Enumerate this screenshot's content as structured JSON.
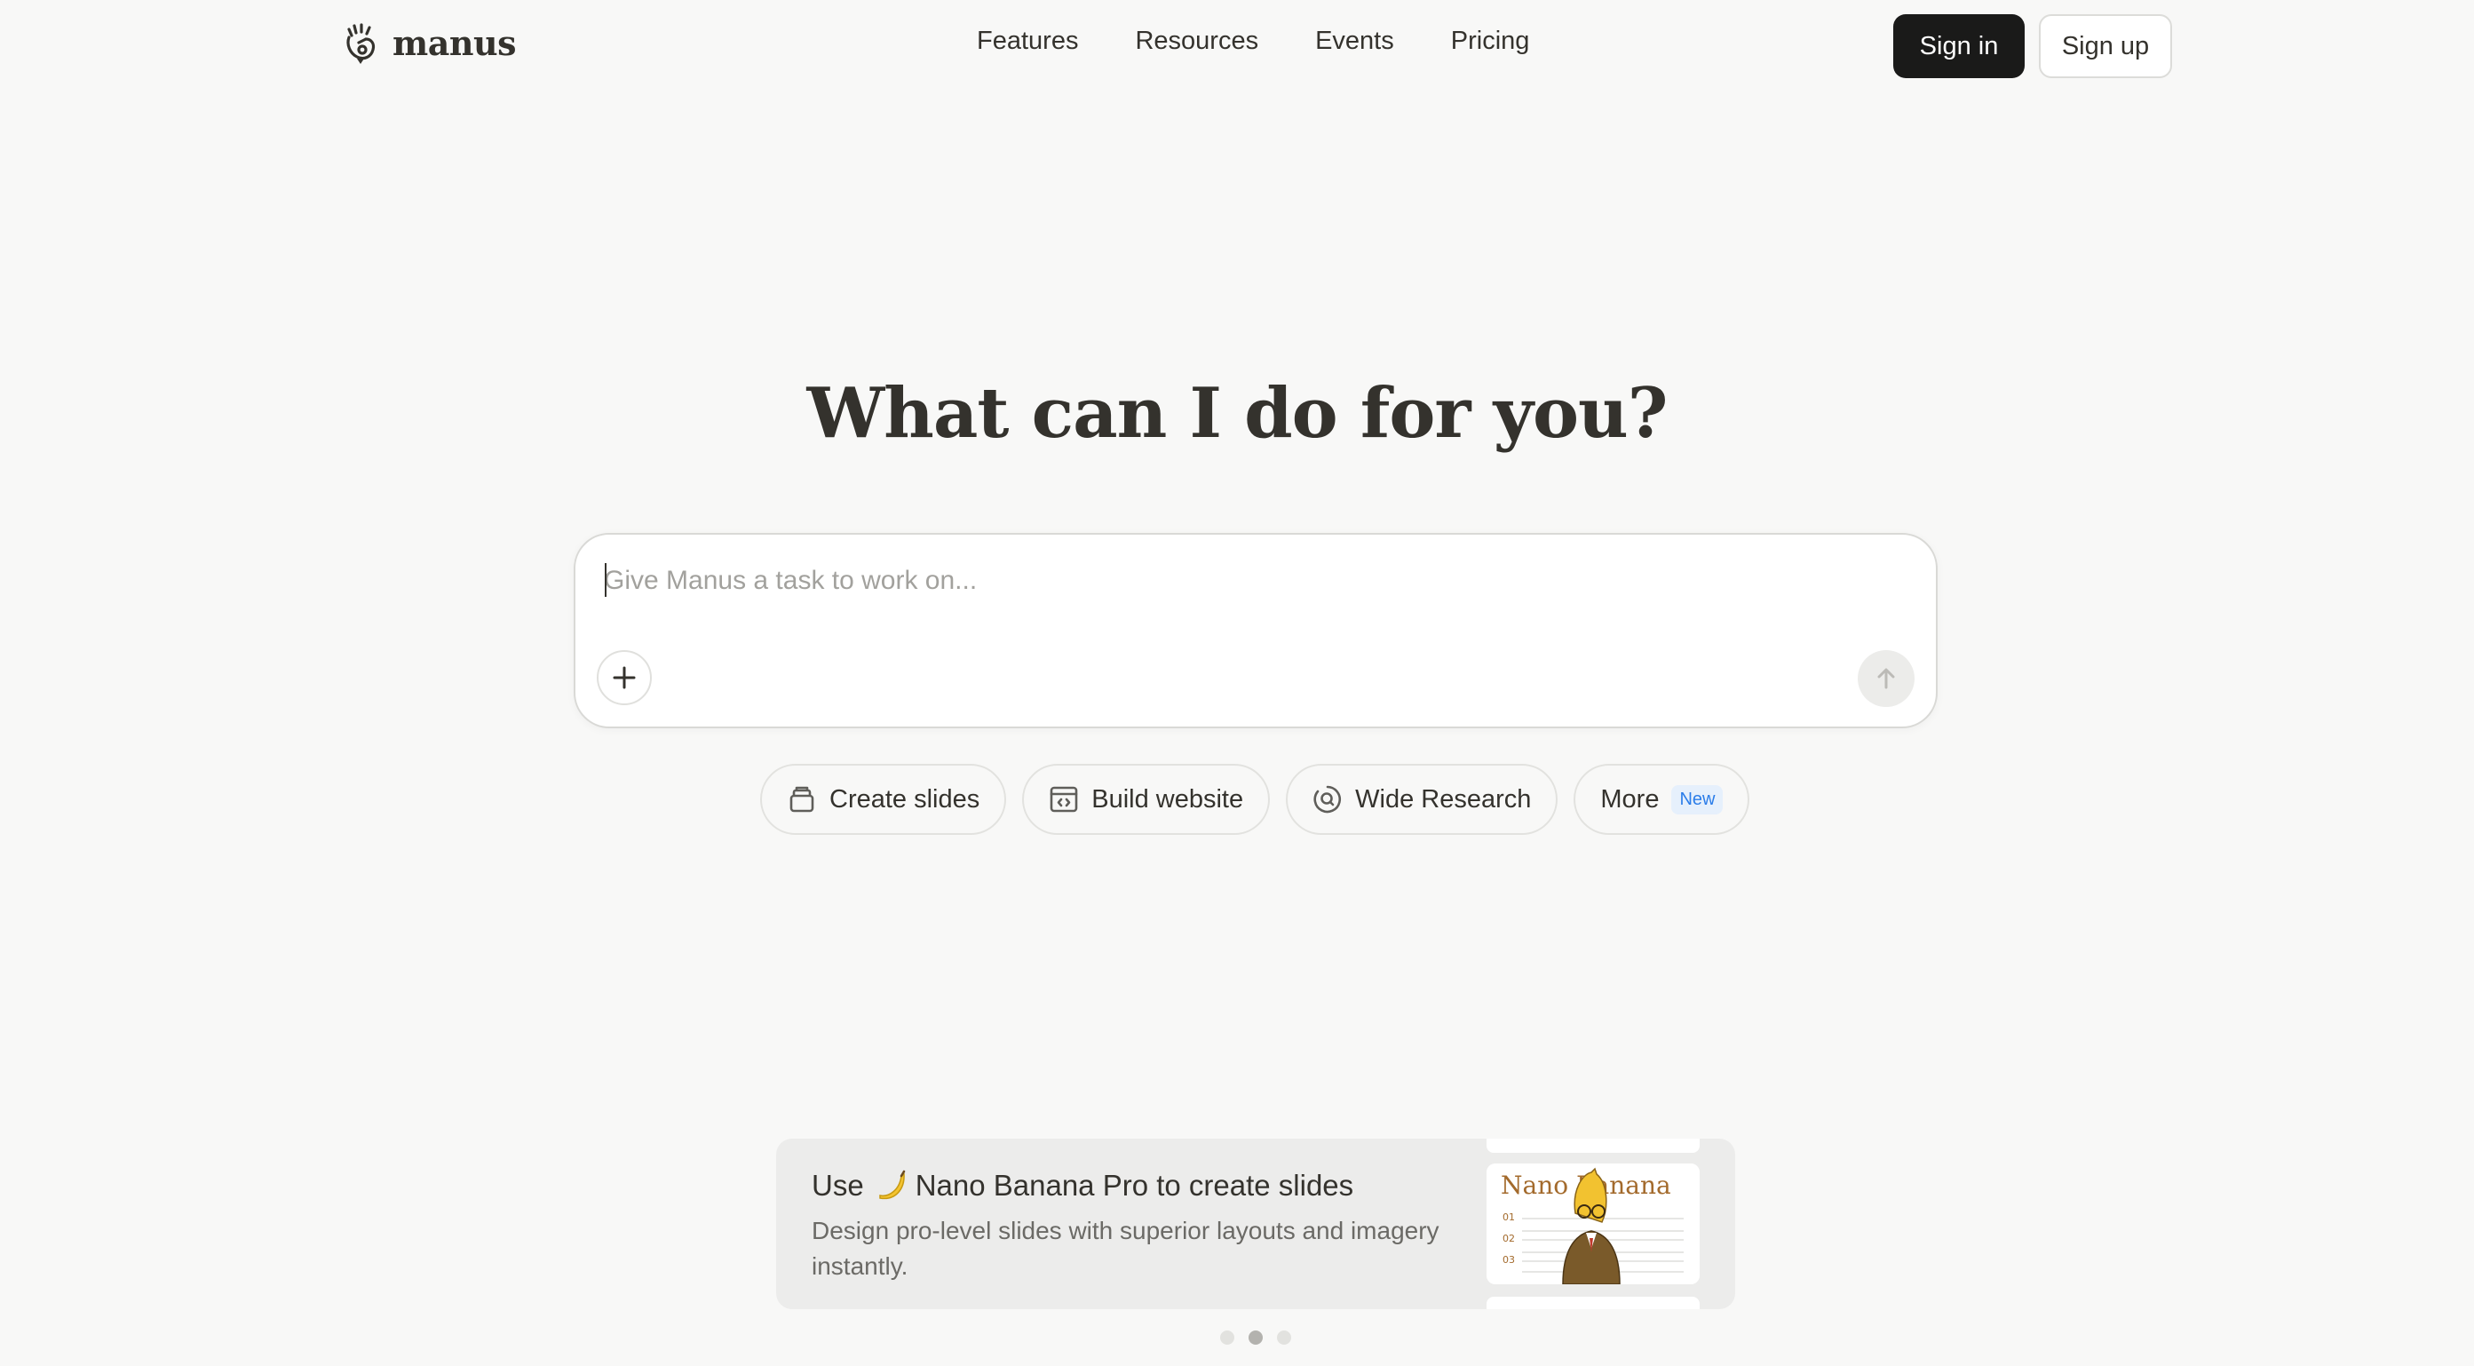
{
  "brand": {
    "name": "manus"
  },
  "nav": {
    "items": [
      {
        "label": "Features"
      },
      {
        "label": "Resources"
      },
      {
        "label": "Events"
      },
      {
        "label": "Pricing"
      }
    ]
  },
  "auth": {
    "sign_in": "Sign in",
    "sign_up": "Sign up"
  },
  "hero": {
    "title": "What can I do for you?"
  },
  "composer": {
    "placeholder": "Give Manus a task to work on...",
    "value": ""
  },
  "chips": [
    {
      "label": "Create slides",
      "icon": "slides-icon"
    },
    {
      "label": "Build website",
      "icon": "code-window-icon"
    },
    {
      "label": "Wide Research",
      "icon": "research-icon"
    },
    {
      "label": "More",
      "badge": "New"
    }
  ],
  "promo": {
    "title_prefix": "Use",
    "title_suffix": "Nano Banana Pro to create slides",
    "description": "Design pro-level slides with superior layouts and imagery instantly.",
    "thumbnail": {
      "heading": "Nano Banana",
      "rows": [
        "01",
        "02",
        "03"
      ]
    }
  },
  "pagination": {
    "count": 3,
    "active_index": 1
  },
  "colors": {
    "background": "#f8f8f7",
    "text": "#34322d",
    "primary_button": "#1a1a19",
    "new_badge_bg": "#e6f0fc",
    "new_badge_text": "#2b7de9"
  }
}
